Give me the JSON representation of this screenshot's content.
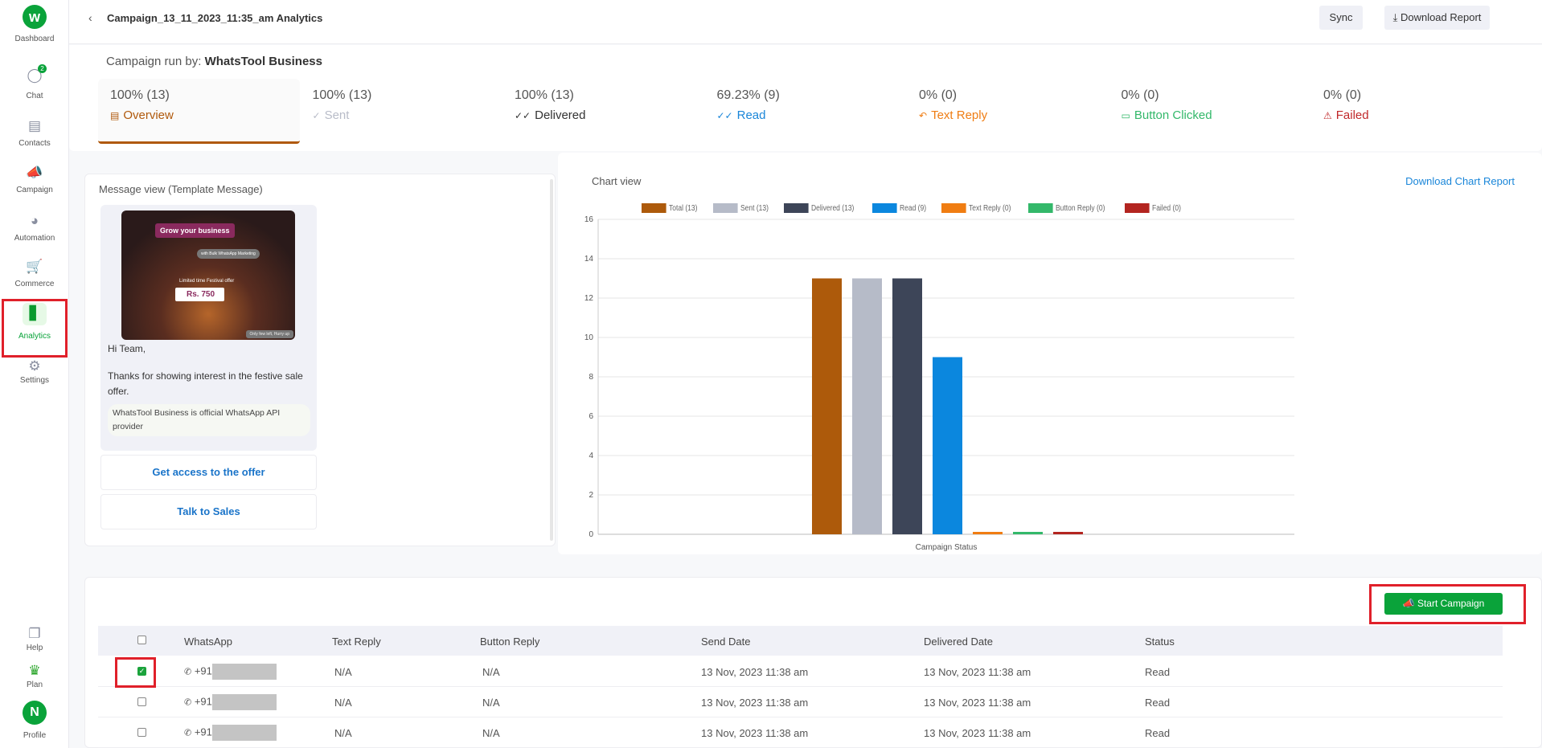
{
  "sidebar": {
    "items": [
      {
        "label": "Dashboard",
        "icon": "whatstool-logo"
      },
      {
        "label": "Chat",
        "icon": "chat-icon",
        "badge": "2"
      },
      {
        "label": "Contacts",
        "icon": "contacts-icon"
      },
      {
        "label": "Campaign",
        "icon": "megaphone-icon"
      },
      {
        "label": "Automation",
        "icon": "bot-icon"
      },
      {
        "label": "Commerce",
        "icon": "cart-icon"
      },
      {
        "label": "Analytics",
        "icon": "bar-chart-icon",
        "active": true
      },
      {
        "label": "Settings",
        "icon": "gear-icon"
      },
      {
        "label": "Help",
        "icon": "help-icon"
      },
      {
        "label": "Plan",
        "icon": "crown-icon"
      },
      {
        "label": "Profile",
        "icon": "avatar",
        "initial": "N"
      }
    ]
  },
  "header": {
    "title": "Campaign_13_11_2023_11:35_am Analytics",
    "sync": "Sync",
    "download": "Download Report"
  },
  "campaign": {
    "run_by_label": "Campaign run by:",
    "run_by": "WhatsTool Business"
  },
  "stats": [
    {
      "value": "100% (13)",
      "label": "Overview",
      "color": "#b0590c"
    },
    {
      "value": "100% (13)",
      "label": "Sent",
      "color": "#b8bcc8"
    },
    {
      "value": "100% (13)",
      "label": "Delivered",
      "color": "#333333"
    },
    {
      "value": "69.23% (9)",
      "label": "Read",
      "color": "#1a86d9"
    },
    {
      "value": "0% (0)",
      "label": "Text Reply",
      "color": "#ef7d14"
    },
    {
      "value": "0% (0)",
      "label": "Button Clicked",
      "color": "#33b86a"
    },
    {
      "value": "0% (0)",
      "label": "Failed",
      "color": "#c0282a"
    }
  ],
  "message": {
    "title": "Message view (Template Message)",
    "image_text": {
      "headline": "Grow your business",
      "sub": "with Bulk WhatsApp Marketing",
      "offer": "Limited time Festival offer",
      "price": "Rs. 750",
      "footer": "Only few left, Hurry up"
    },
    "body_1": "Hi Team,",
    "body_2": "Thanks for showing interest in the festive sale offer.",
    "footer": "WhatsTool Business is official WhatsApp API provider",
    "buttons": [
      "Get access to the offer",
      "Talk to Sales"
    ]
  },
  "chart": {
    "title": "Chart view",
    "download": "Download Chart Report"
  },
  "chart_data": {
    "type": "bar",
    "xlabel": "Campaign Status",
    "categories": [
      "Campaign Status"
    ],
    "ylim": [
      0,
      16
    ],
    "yticks": [
      0,
      2,
      4,
      6,
      8,
      10,
      12,
      14,
      16
    ],
    "grid": true,
    "legend": "top",
    "series": [
      {
        "name": "Total (13)",
        "values": [
          13
        ],
        "color": "#ad5a0b"
      },
      {
        "name": "Sent (13)",
        "values": [
          13
        ],
        "color": "#b6bbc8"
      },
      {
        "name": "Delivered (13)",
        "values": [
          13
        ],
        "color": "#3d4558"
      },
      {
        "name": "Read (9)",
        "values": [
          9
        ],
        "color": "#0b87de"
      },
      {
        "name": "Text Reply (0)",
        "values": [
          0
        ],
        "color": "#f07d12"
      },
      {
        "name": "Button Reply (0)",
        "values": [
          0
        ],
        "color": "#33b86a"
      },
      {
        "name": "Failed (0)",
        "values": [
          0
        ],
        "color": "#b32520"
      }
    ]
  },
  "table": {
    "start_campaign": "Start Campaign",
    "columns": [
      "WhatsApp",
      "Text Reply",
      "Button Reply",
      "Send Date",
      "Delivered Date",
      "Status"
    ],
    "rows": [
      {
        "checked": true,
        "whatsapp": "+91",
        "text_reply": "N/A",
        "button_reply": "N/A",
        "send_date": "13 Nov, 2023 11:38 am",
        "delivered_date": "13 Nov, 2023 11:38 am",
        "status": "Read"
      },
      {
        "checked": false,
        "whatsapp": "+91",
        "text_reply": "N/A",
        "button_reply": "N/A",
        "send_date": "13 Nov, 2023 11:38 am",
        "delivered_date": "13 Nov, 2023 11:38 am",
        "status": "Read"
      },
      {
        "checked": false,
        "whatsapp": "+91",
        "text_reply": "N/A",
        "button_reply": "N/A",
        "send_date": "13 Nov, 2023 11:38 am",
        "delivered_date": "13 Nov, 2023 11:38 am",
        "status": "Read"
      }
    ]
  },
  "colors": {
    "brand": "#0aa33a",
    "accent": "#1a86d9",
    "highlight": "#e0202a"
  }
}
